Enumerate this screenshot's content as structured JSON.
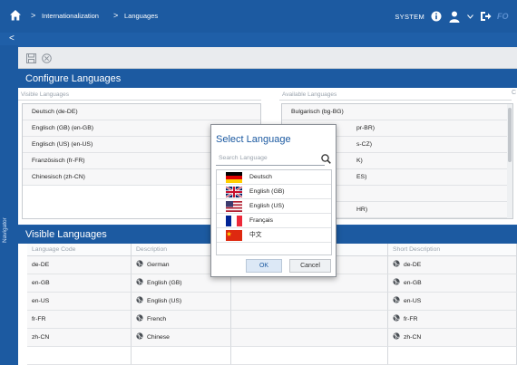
{
  "breadcrumb": [
    "Internationalization",
    "Languages"
  ],
  "header": {
    "system_label": "SYSTEM",
    "brand": "FO"
  },
  "navigator_label": "Navigator",
  "configure": {
    "title": "Configure Languages",
    "visible_header": "Visible Languages",
    "available_header": "Available Languages",
    "visible_items": [
      "Deutsch (de-DE)",
      "Englisch (GB) (en-GB)",
      "Englisch (US) (en-US)",
      "Französisch (fr-FR)",
      "Chinesisch (zh-CN)"
    ],
    "available_items": [
      "Bulgarisch (bg-BG)",
      "pr-BR)",
      "s-CZ)",
      "K)",
      "ES)",
      "",
      "HR)"
    ]
  },
  "visible_table": {
    "title": "Visible Languages",
    "columns": [
      "Language Code",
      "Description",
      "",
      "Short Description"
    ],
    "rows": [
      {
        "code": "de-DE",
        "description": "German",
        "short": "de-DE"
      },
      {
        "code": "en-GB",
        "description": "English (GB)",
        "short": "en-GB"
      },
      {
        "code": "en-US",
        "description": "English (US)",
        "short": "en-US"
      },
      {
        "code": "fr-FR",
        "description": "French",
        "short": "fr-FR"
      },
      {
        "code": "zh-CN",
        "description": "Chinese",
        "short": "zh-CN"
      }
    ]
  },
  "dialog": {
    "title": "Select Language",
    "search_placeholder": "Search Language",
    "languages": [
      {
        "name": "Deutsch",
        "flag": "de-flag"
      },
      {
        "name": "English (GB)",
        "flag": "gb-flag"
      },
      {
        "name": "English (US)",
        "flag": "us-flag"
      },
      {
        "name": "Français",
        "flag": "fr-flag"
      },
      {
        "name": "中文",
        "flag": "cn-flag"
      }
    ],
    "ok_label": "OK",
    "cancel_label": "Cancel"
  },
  "colors": {
    "primary": "#1c5aa1",
    "panel_bg": "#ffffff",
    "row_bg": "#f7f7f8"
  }
}
